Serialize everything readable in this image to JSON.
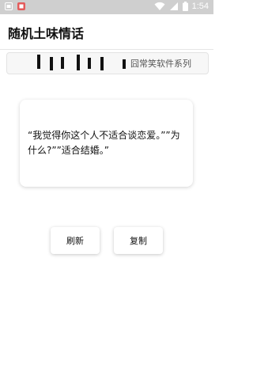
{
  "status": {
    "time": "1:54",
    "colors": {
      "bar": "#cfcfcf",
      "icons": "#ffffff",
      "notif": "#e35b5b"
    },
    "icons": [
      "notification-icon",
      "app-icon",
      "wifi-icon",
      "signal-icon",
      "battery-icon"
    ]
  },
  "app": {
    "title": "随机土味情话"
  },
  "banner": {
    "marquee": "囧常笑软件系列"
  },
  "card": {
    "text": "“我觉得你这个人不适合谈恋爱。””为什么?””适合结婚。”"
  },
  "buttons": {
    "refresh": "刷新",
    "copy": "复制"
  }
}
